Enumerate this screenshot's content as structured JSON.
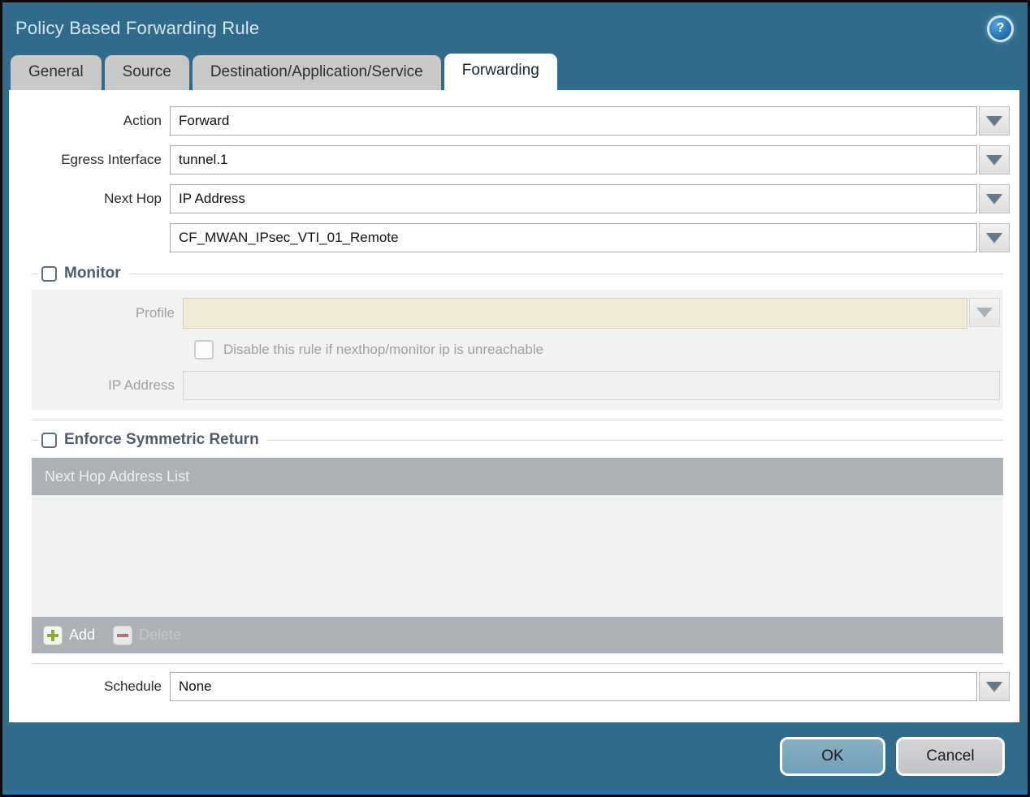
{
  "dialog": {
    "title": "Policy Based Forwarding Rule",
    "help_icon_glyph": "?"
  },
  "tabs": [
    {
      "label": "General",
      "active": false
    },
    {
      "label": "Source",
      "active": false
    },
    {
      "label": "Destination/Application/Service",
      "active": false
    },
    {
      "label": "Forwarding",
      "active": true
    }
  ],
  "form": {
    "action": {
      "label": "Action",
      "value": "Forward"
    },
    "egress_interface": {
      "label": "Egress Interface",
      "value": "tunnel.1"
    },
    "next_hop": {
      "label": "Next Hop",
      "value": "IP Address"
    },
    "next_hop_address": {
      "value": "CF_MWAN_IPsec_VTI_01_Remote"
    },
    "monitor": {
      "label": "Monitor",
      "checked": false,
      "profile": {
        "label": "Profile",
        "value": ""
      },
      "disable_rule": {
        "label": "Disable this rule if nexthop/monitor ip is unreachable",
        "checked": false
      },
      "ip_address": {
        "label": "IP Address",
        "value": ""
      }
    },
    "enforce_symmetric_return": {
      "label": "Enforce Symmetric Return",
      "checked": false,
      "table": {
        "header": "Next Hop Address List",
        "rows": []
      },
      "add_label": "Add",
      "delete_label": "Delete",
      "delete_enabled": false
    },
    "schedule": {
      "label": "Schedule",
      "value": "None"
    }
  },
  "footer": {
    "ok_label": "OK",
    "cancel_label": "Cancel"
  },
  "colors": {
    "dialog_frame": "#306b8c",
    "title_text": "#d6e7f1",
    "active_tab_bg": "#ffffff",
    "inactive_tab_bg": "#c9c9c9",
    "disabled_panel_bg": "#f2f2f3",
    "disabled_combo_bg": "#f0ead7",
    "table_chrome_bg": "#acb1b5",
    "table_body_bg": "#f0f1f1",
    "add_icon_green": "#8dab3c",
    "delete_icon_red": "#b27472",
    "ok_button_bg": "#7aa8bd",
    "cancel_button_bg": "#c9cbce"
  }
}
